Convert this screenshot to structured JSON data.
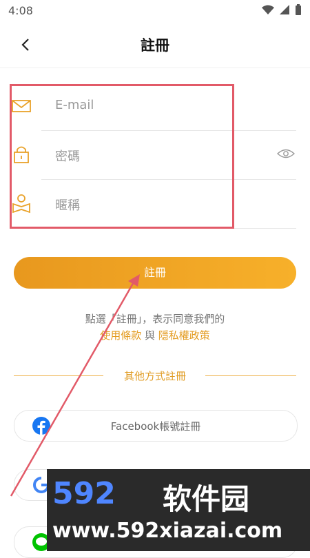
{
  "status": {
    "time": "4:08"
  },
  "header": {
    "title": "註冊"
  },
  "form": {
    "email_placeholder": "E-mail",
    "password_placeholder": "密碼",
    "nickname_placeholder": "暱稱"
  },
  "actions": {
    "register_label": "註冊"
  },
  "agreement": {
    "prefix": "點選「註冊」，表示同意我們的",
    "terms": "使用條款",
    "and": " 與 ",
    "privacy": "隱私權政策"
  },
  "other": {
    "divider": "其他方式註冊",
    "facebook_label": "Facebook帳號註冊"
  },
  "watermark": {
    "number": "592",
    "chinese": "软件园",
    "url": "www.592xiazai.com"
  },
  "colors": {
    "accent": "#f0a52a",
    "highlight_box": "#e25a68",
    "facebook": "#1877f2",
    "line": "#00c300"
  }
}
